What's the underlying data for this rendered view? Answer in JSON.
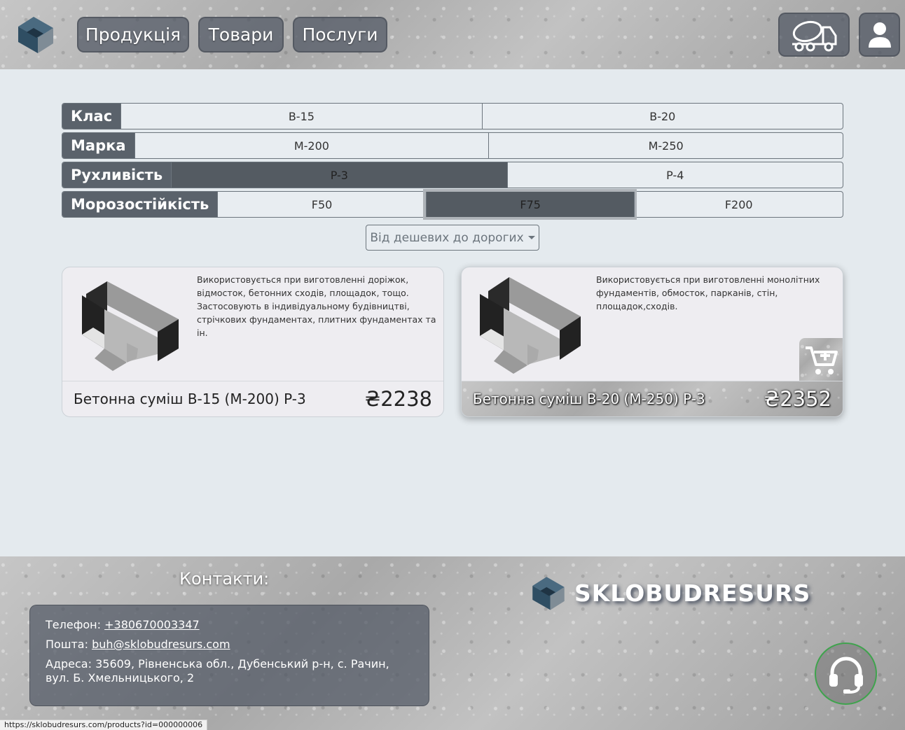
{
  "header": {
    "nav": [
      "Продукція",
      "Товари",
      "Послуги"
    ],
    "icons": [
      "concrete-mixer-truck-icon",
      "user-icon"
    ]
  },
  "filters": [
    {
      "label": "Клас",
      "options": [
        "B-15",
        "B-20"
      ],
      "selected": "none"
    },
    {
      "label": "Марка",
      "options": [
        "M-200",
        "M-250"
      ],
      "selected": "none"
    },
    {
      "label": "Рухливість",
      "options": [
        "P-3",
        "P-4"
      ],
      "selected": "P-3"
    },
    {
      "label": "Морозостійкість",
      "options": [
        "F50",
        "F75",
        "F200"
      ],
      "selected": "F75"
    }
  ],
  "sort": {
    "label": "Від дешевих до дорогих"
  },
  "products": [
    {
      "description": "Використовується при виготовленні доріжок, відмосток, бетонних сходів, площадок, тощо. Застосовують в індивідуальному будівництві, стрічкових фундаментах, плитних фундаментах та ін.",
      "name": "Бетонна суміш B-15 (M-200) P-3",
      "price": "₴2238"
    },
    {
      "description": "Використовується при виготовленні монолітних фундаментів, обмосток, парканів, стін, площадок,сходів.",
      "name": "Бетонна суміш B-20 (M-250) P-3",
      "price": "₴2352"
    }
  ],
  "footer": {
    "contacts_title": "Контакти:",
    "phone_label": "Телефон:",
    "phone": "+380670003347",
    "email_label": "Пошта:",
    "email": "buh@sklobudresurs.com",
    "address": "Адреса: 35609, Рівненська обл., Дубенський р-н, с. Рачин, вул. Б. Хмельницького, 2",
    "brand": "SKLOBUDRESURS"
  },
  "status_url": "https://sklobudresurs.com/products?id=000000006",
  "colors": {
    "accent": "#5a626b",
    "support_ring": "#3fa34d",
    "page_bg": "#e4eaee"
  }
}
